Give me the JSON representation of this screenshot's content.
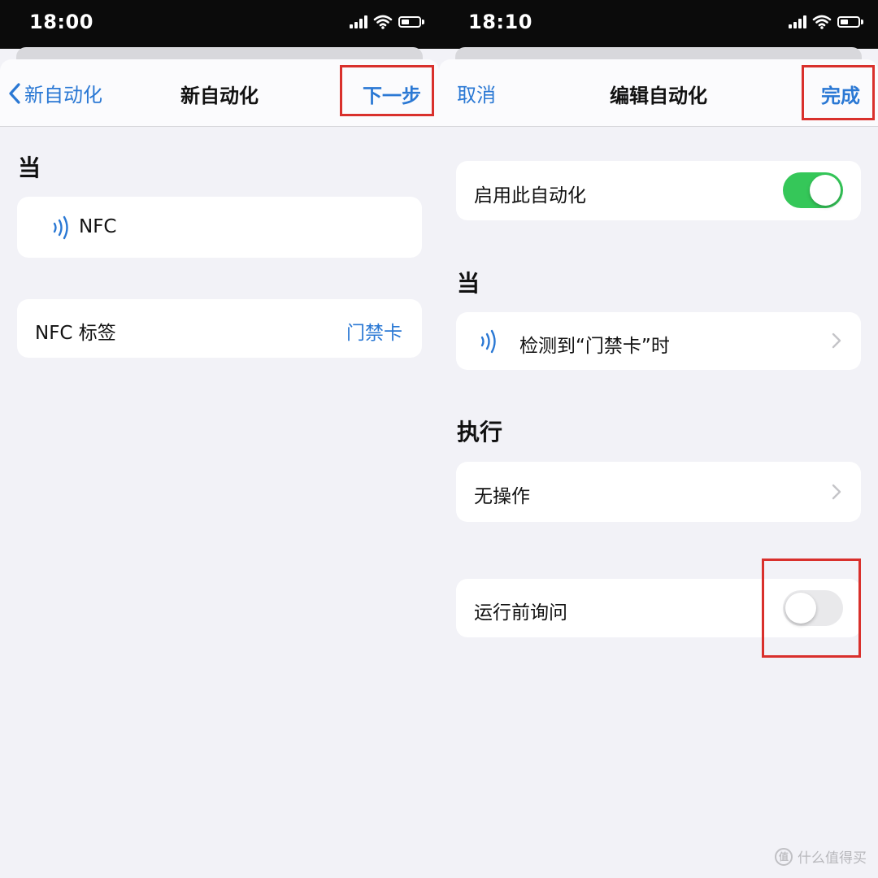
{
  "colors": {
    "accent": "#2a78d4",
    "toggle_on": "#35c759",
    "toggle_off": "#e9e9eb",
    "highlight_box": "#d9302c"
  },
  "left": {
    "status_time": "18:00",
    "nav": {
      "back_label": "新自动化",
      "title": "新自动化",
      "next_label": "下一步"
    },
    "section_when": "当",
    "trigger_label": "NFC",
    "tag_row": {
      "label": "NFC 标签",
      "value": "门禁卡"
    }
  },
  "right": {
    "status_time": "18:10",
    "nav": {
      "cancel_label": "取消",
      "title": "编辑自动化",
      "done_label": "完成"
    },
    "enable_row": {
      "label": "启用此自动化",
      "toggle_on": true
    },
    "section_when": "当",
    "trigger_row": {
      "label": "检测到“门禁卡”时"
    },
    "section_do": "执行",
    "action_row": {
      "label": "无操作"
    },
    "ask_row": {
      "label": "运行前询问",
      "toggle_on": false
    }
  },
  "watermark": {
    "badge": "值",
    "text": "什么值得买"
  }
}
